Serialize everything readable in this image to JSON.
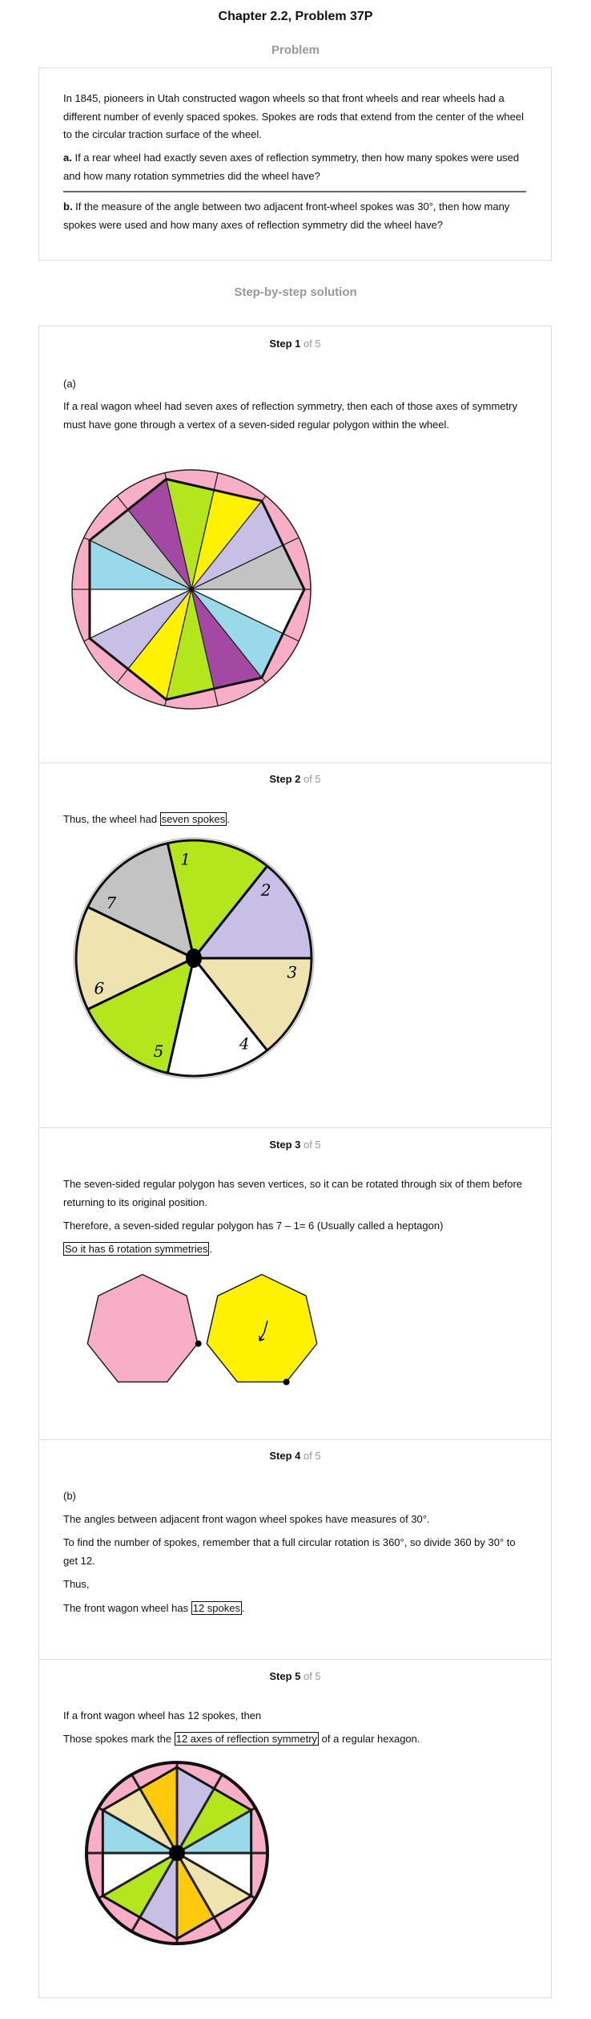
{
  "header": {
    "title": "Chapter 2.2, Problem 37P",
    "problem_label": "Problem",
    "solution_label": "Step-by-step solution"
  },
  "problem": {
    "intro": "In 1845, pioneers in Utah constructed wagon wheels so that front wheels and rear wheels had a different number of evenly spaced spokes. Spokes are rods that extend from the center of the wheel to the circular traction surface of the wheel.",
    "a_label": "a.",
    "a_text": " If a rear wheel had exactly seven axes of reflection symmetry, then how many spokes were used and how many rotation symmetries did the wheel have?",
    "b_label": "b.",
    "b_text": " If the measure of the angle between two adjacent front-wheel spokes was 30°, then how many spokes were used and how many axes of reflection symmetry did the wheel have?"
  },
  "steps": [
    {
      "label": "Step 1",
      "of": " of 5",
      "part": "(a)",
      "text": "If a real wagon wheel had seven axes of reflection symmetry, then each of those axes of symmetry must have gone through a vertex of a seven-sided regular polygon within the wheel."
    },
    {
      "label": "Step 2",
      "of": " of 5",
      "prefix": "Thus, the wheel had ",
      "boxed": "seven spokes",
      "suffix": ".",
      "wheel_labels": [
        "1",
        "2",
        "3",
        "4",
        "5",
        "6",
        "7"
      ]
    },
    {
      "label": "Step 3",
      "of": " of 5",
      "text1": "The seven-sided regular polygon has seven vertices, so it can be rotated through six of them before returning to its original position.",
      "text2": "Therefore, a seven-sided regular polygon has 7 – 1= 6 (Usually called a heptagon)",
      "boxed": "So it has 6 rotation symmetries",
      "suffix": "."
    },
    {
      "label": "Step 4",
      "of": " of 5",
      "part": "(b)",
      "text1": "The angles between adjacent front wagon wheel spokes have measures of 30°.",
      "text2": "To find the number of spokes, remember that a full circular rotation is 360°, so divide 360 by 30° to get 12.",
      "text3": "Thus,",
      "prefix": "The front wagon wheel has ",
      "boxed": "12 spokes",
      "suffix": "."
    },
    {
      "label": "Step 5",
      "of": " of 5",
      "text1": "If a front wagon wheel has 12 spokes, then",
      "prefix": "Those spokes mark the ",
      "boxed": "12 axes of reflection symmetry",
      "suffix": " of a regular hexagon."
    }
  ],
  "colors": {
    "pink": "#f9aec8",
    "purple": "#a349a4",
    "green": "#b5e61d",
    "yellow": "#fff200",
    "lavender": "#c8bfe7",
    "gray": "#c3c3c3",
    "blue": "#99d9ea",
    "tan": "#efe4b0",
    "orange": "#ffc90e",
    "white": "#ffffff"
  }
}
